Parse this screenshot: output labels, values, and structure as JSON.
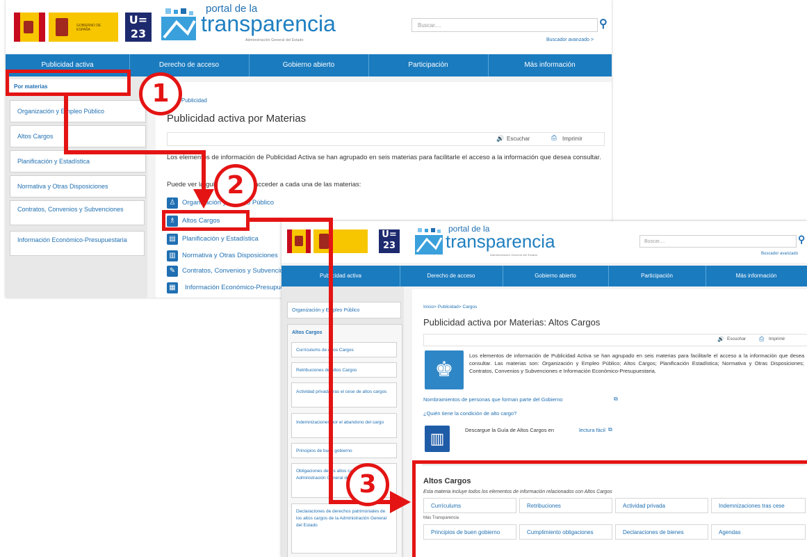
{
  "screen1": {
    "header": {
      "gov_text": "GOBIERNO DE ESPAÑA",
      "ue_label": "U= 23",
      "portal_small": "portal de la",
      "portal_big": "transparencia",
      "portal_sub": "Administración General del Estado",
      "search_placeholder": "Buscar....",
      "advanced_search": "Buscador avanzado >"
    },
    "nav": [
      "Publicidad activa",
      "Derecho de acceso",
      "Gobierno abierto",
      "Participación",
      "Más información"
    ],
    "sidebar": {
      "heading": "Por materias",
      "items": [
        "Organización y Empleo Público",
        "Altos Cargos",
        "Planificación y Estadística",
        "Normativa y Otras Disposiciones",
        "Contratos, Convenios y Subvenciones",
        "Información Económico-Presupuestaria"
      ]
    },
    "breadcrumb": "> Publicidad",
    "title": "Publicidad activa por Materias",
    "listen": "Escuchar",
    "print": "Imprimir",
    "intro": "Los elementos de información de Publicidad Activa se han agrupado en seis materias para facilitarle el acceso a la información que desea consultar.",
    "subintro": "Puede ver la guía completa o acceder a cada una de las materias:",
    "materias": [
      "Organización y Empleo Público",
      "Altos Cargos",
      "Planificación y Estadística",
      "Normativa y Otras Disposiciones",
      "Contratos, Convenios y Subvenciones",
      "Información Económico-Presupuestaria"
    ]
  },
  "screen2": {
    "header": {
      "portal_small": "portal de la",
      "portal_big": "transparencia",
      "portal_sub": "Administración General del Estado",
      "search_placeholder": "Buscar....",
      "advanced_search": "Buscador avanzado"
    },
    "nav": [
      "Publicidad activa",
      "Derecho de acceso",
      "Gobierno abierto",
      "Participación",
      "Más información"
    ],
    "sidebar": {
      "top": "Organización y Empleo Público",
      "group": "Altos Cargos",
      "items": [
        "Currículums de Altos Cargos",
        "Retribuciones de Altos Cargos",
        "Actividad privada tras el cese de altos cargos",
        "Indemnizaciones por el abandono del cargo",
        "Principios de buen gobierno",
        "Obligaciones de los altos cargos de la Administración General del Estado",
        "Declaraciones de derechos patrimoniales de los altos cargos de la Administración General del Estado"
      ]
    },
    "breadcrumb": "Inicio> Publicidad> Cargos",
    "title": "Publicidad activa por Materias: Altos Cargos",
    "listen": "Escuchar",
    "print": "Imprimir",
    "intro": "Los elementos de información de Publicidad Activa se han agrupado en seis materias para facilitarle el acceso a la información que desea consultar. Las materias son: Organización y Empleo Público; Altos Cargos; Planificación Estadística; Normativa y Otras Disposiciones; Contratos, Convenios y Subvenciones e Información Económico-Presupuestaria.",
    "link1": "Nombramientos de personas que forman parte del Gobierno",
    "link2": "¿Quién tiene la condición de alto cargo?",
    "guide_text": "Descargue la Guía de Altos Cargos en",
    "guide_link": "lectura fácil",
    "box_title": "Altos Cargos",
    "box_desc": "Esta materia incluye todos los elementos de información relacionados con Altos Cargos",
    "row1": [
      "Currículums",
      "Retribuciones",
      "Actividad privada",
      "Indemnizaciones tras cese"
    ],
    "more_label": "Más Transparencia",
    "row2": [
      "Principios de buen gobierno",
      "Cumplimiento obligaciones",
      "Declaraciones de bienes",
      "Agendas"
    ]
  },
  "steps": [
    "1",
    "2",
    "3"
  ],
  "colors": {
    "accent": "#1a7bbf",
    "highlight": "#e41414"
  }
}
